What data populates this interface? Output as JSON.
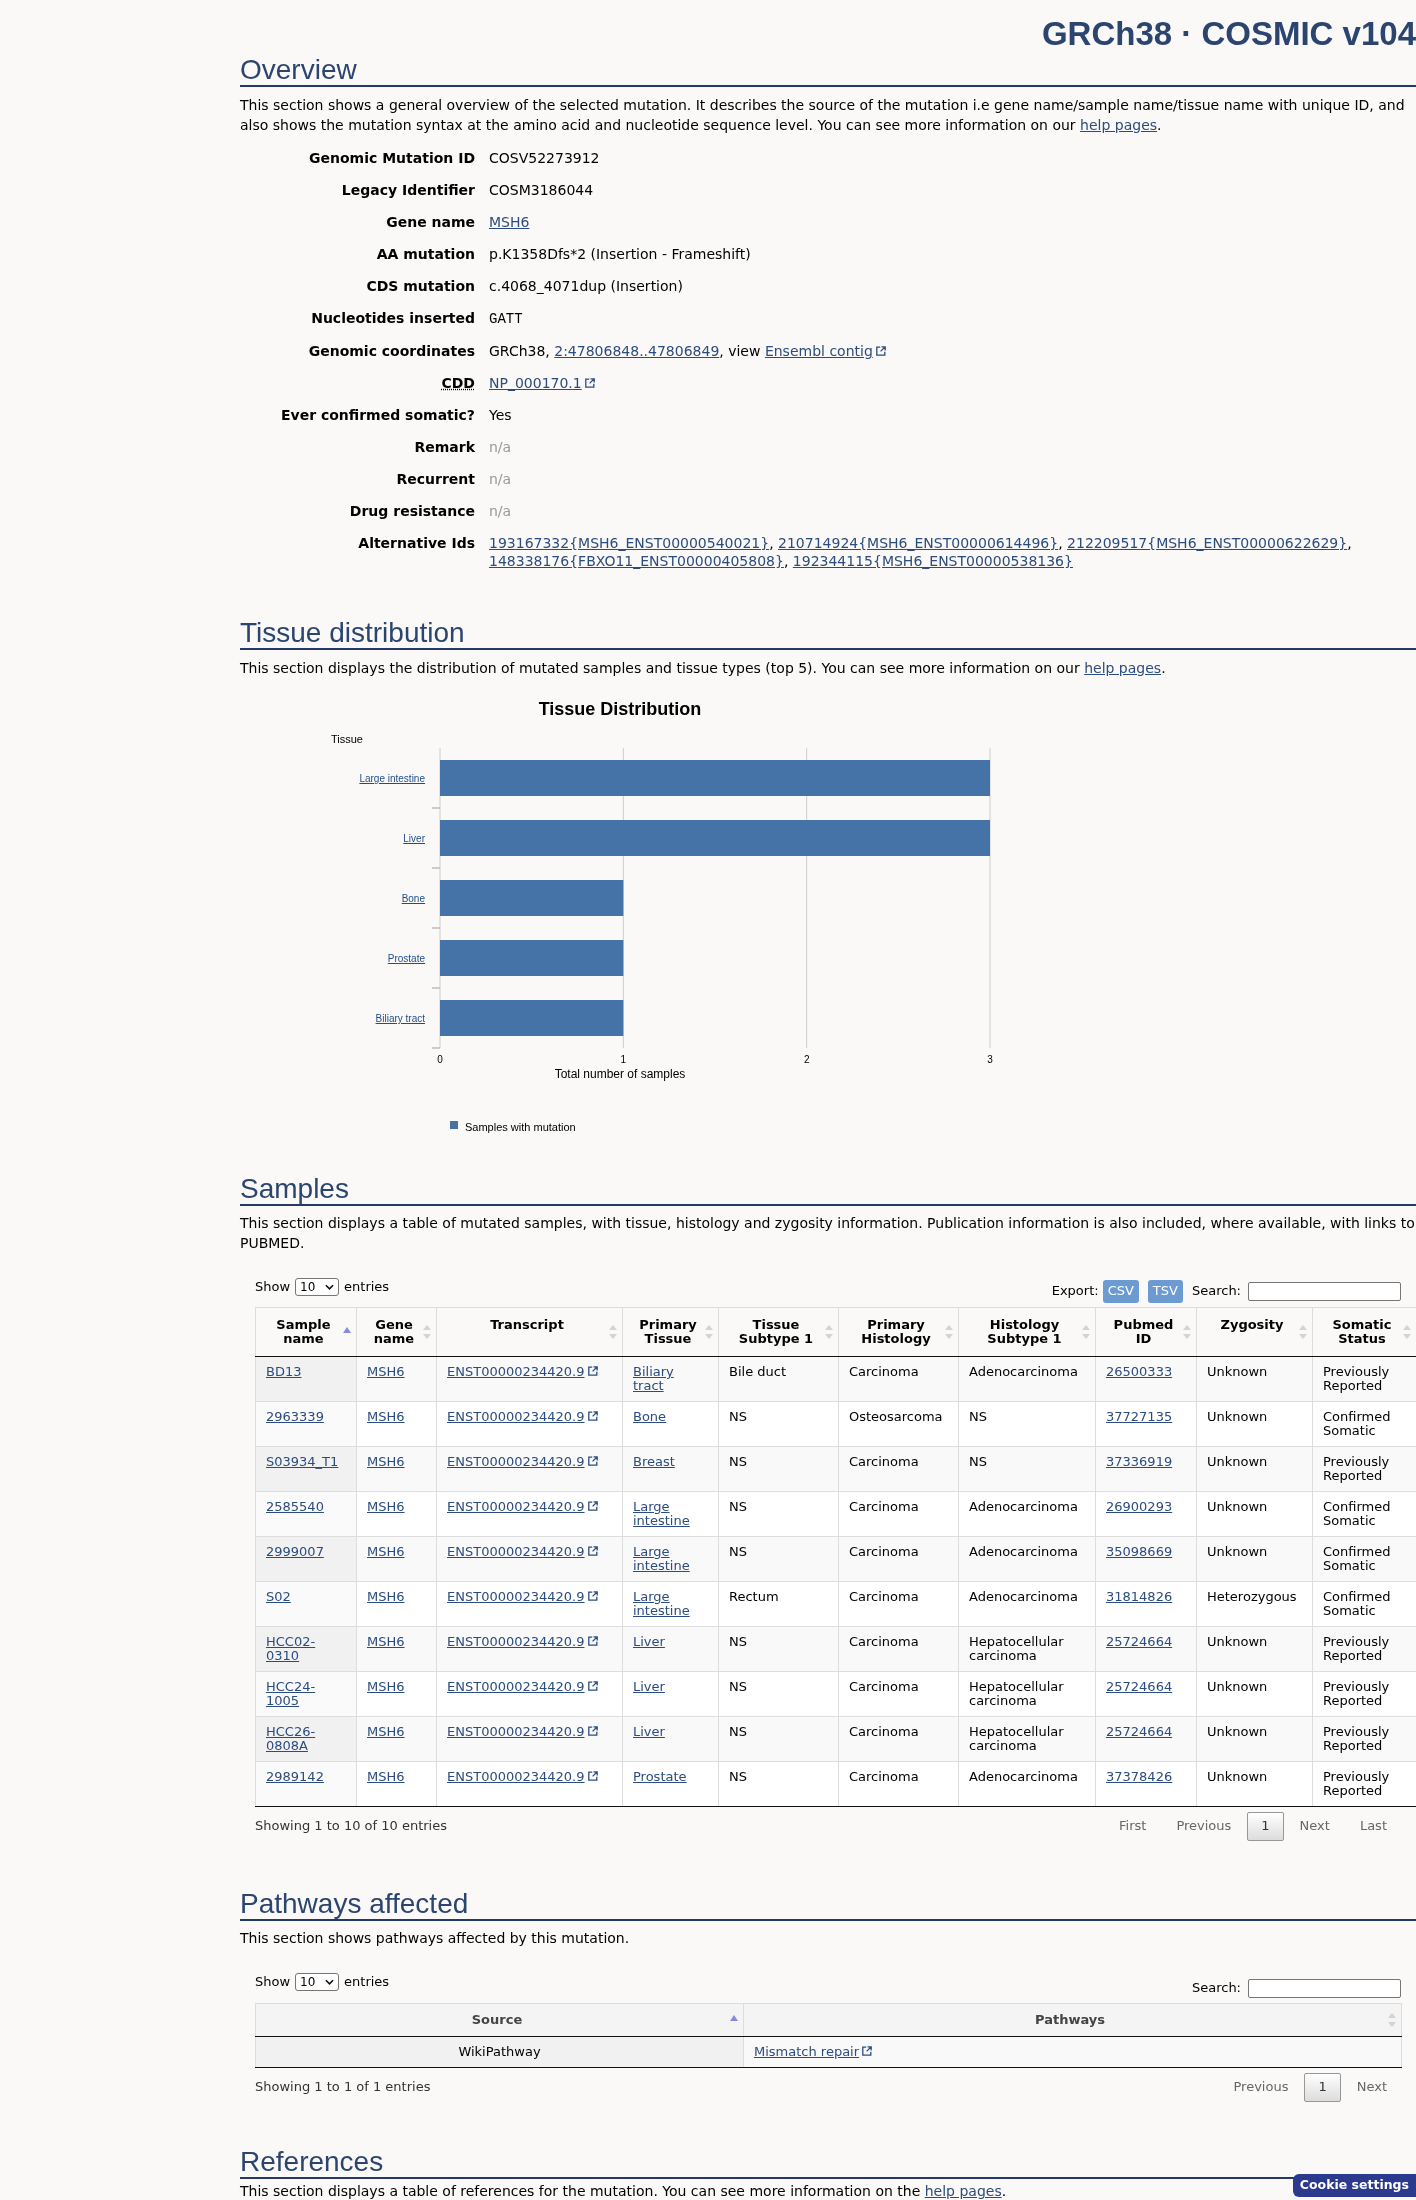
{
  "header": {
    "title": "GRCh38 · COSMIC v104"
  },
  "overview": {
    "heading": "Overview",
    "description": [
      {
        "kind": "text",
        "text": "This section shows a general overview of the selected mutation. It describes the source of the mutation i.e gene name/sample name/tissue name with unique ID, and also shows the mutation syntax at the amino acid and nucleotide sequence level. You can see more information on our "
      },
      {
        "kind": "link",
        "text": "help pages"
      },
      {
        "kind": "text",
        "text": "."
      }
    ],
    "rows": [
      {
        "label": "Genomic Mutation ID",
        "abbr": false,
        "value": [
          {
            "kind": "text",
            "text": "COSV52273912"
          }
        ]
      },
      {
        "label": "Legacy Identifier",
        "abbr": false,
        "value": [
          {
            "kind": "text",
            "text": "COSM3186044"
          }
        ]
      },
      {
        "label": "Gene name",
        "abbr": false,
        "value": [
          {
            "kind": "link",
            "text": "MSH6"
          }
        ]
      },
      {
        "label": "AA mutation",
        "abbr": false,
        "value": [
          {
            "kind": "text",
            "text": "p.K1358Dfs*2 (Insertion - Frameshift)"
          }
        ]
      },
      {
        "label": "CDS mutation",
        "abbr": false,
        "value": [
          {
            "kind": "text",
            "text": "c.4068_4071dup (Insertion)"
          }
        ]
      },
      {
        "label": "Nucleotides inserted",
        "abbr": false,
        "value": [
          {
            "kind": "code",
            "text": "GATT"
          }
        ]
      },
      {
        "label": "Genomic coordinates",
        "abbr": false,
        "value": [
          {
            "kind": "text",
            "text": "GRCh38, "
          },
          {
            "kind": "link",
            "text": "2:47806848..47806849"
          },
          {
            "kind": "text",
            "text": ", view "
          },
          {
            "kind": "external_link",
            "text": "Ensembl contig"
          }
        ]
      },
      {
        "label": "CDD",
        "abbr": true,
        "value": [
          {
            "kind": "external_link",
            "text": "NP_000170.1"
          }
        ]
      },
      {
        "label": "Ever confirmed somatic?",
        "abbr": false,
        "value": [
          {
            "kind": "text",
            "text": "Yes"
          }
        ]
      },
      {
        "label": "Remark",
        "abbr": false,
        "value": [
          {
            "kind": "muted",
            "text": "n/a"
          }
        ]
      },
      {
        "label": "Recurrent",
        "abbr": false,
        "value": [
          {
            "kind": "muted",
            "text": "n/a"
          }
        ]
      },
      {
        "label": "Drug resistance",
        "abbr": false,
        "value": [
          {
            "kind": "muted",
            "text": "n/a"
          }
        ]
      },
      {
        "label": "Alternative Ids",
        "abbr": false,
        "value": [
          {
            "kind": "link",
            "text": "193167332{MSH6_ENST00000540021}"
          },
          {
            "kind": "text",
            "text": ", "
          },
          {
            "kind": "link",
            "text": "210714924{MSH6_ENST00000614496}"
          },
          {
            "kind": "text",
            "text": ", "
          },
          {
            "kind": "link",
            "text": "212209517{MSH6_ENST00000622629}"
          },
          {
            "kind": "text",
            "text": ", "
          },
          {
            "kind": "link",
            "text": "148338176{FBXO11_ENST00000405808}"
          },
          {
            "kind": "text",
            "text": ", "
          },
          {
            "kind": "link",
            "text": "192344115{MSH6_ENST00000538136}"
          }
        ]
      }
    ]
  },
  "tissue_distribution": {
    "heading": "Tissue distribution",
    "description": [
      {
        "kind": "text",
        "text": "This section displays the distribution of mutated samples and tissue types (top 5). You can see more information on our "
      },
      {
        "kind": "link",
        "text": "help pages"
      },
      {
        "kind": "text",
        "text": "."
      }
    ],
    "chart_data": {
      "type": "bar",
      "orientation": "horizontal",
      "title": "Tissue Distribution",
      "xlabel": "Total number of samples",
      "ylabel": "Tissue",
      "categories": [
        "Large intestine",
        "Liver",
        "Bone",
        "Prostate",
        "Biliary tract"
      ],
      "series": [
        {
          "name": "Samples with mutation",
          "color": "#4573a7",
          "values": [
            3,
            3,
            1,
            1,
            1
          ]
        }
      ],
      "xlim": [
        0,
        3
      ],
      "xticks": [
        0,
        1,
        2,
        3
      ]
    }
  },
  "samples": {
    "heading": "Samples",
    "description": [
      {
        "kind": "text",
        "text": "This section displays a table of mutated samples, with tissue, histology and zygosity information. Publication information is also included, where available, with links to PUBMED."
      }
    ],
    "length_menu": {
      "label_before": "Show",
      "value": "10",
      "label_after": "entries"
    },
    "export": {
      "label": "Export:",
      "buttons": [
        "CSV",
        "TSV"
      ]
    },
    "search": {
      "label": "Search:"
    },
    "table": {
      "columns": [
        {
          "label": "Sample name",
          "sorted": true
        },
        {
          "label": "Gene name",
          "sorted": false
        },
        {
          "label": "Transcript",
          "sorted": false
        },
        {
          "label": "Primary Tissue",
          "sorted": false
        },
        {
          "label": "Tissue Subtype 1",
          "sorted": false
        },
        {
          "label": "Primary Histology",
          "sorted": false
        },
        {
          "label": "Histology Subtype 1",
          "sorted": false
        },
        {
          "label": "Pubmed ID",
          "sorted": false
        },
        {
          "label": "Zygosity",
          "sorted": false
        },
        {
          "label": "Somatic Status",
          "sorted": false
        }
      ],
      "rows": [
        [
          {
            "kind": "link",
            "text": "BD13"
          },
          {
            "kind": "link",
            "text": "MSH6"
          },
          {
            "kind": "external_link",
            "text": "ENST00000234420.9"
          },
          {
            "kind": "link",
            "text": "Biliary tract"
          },
          {
            "kind": "text",
            "text": "Bile duct"
          },
          {
            "kind": "text",
            "text": "Carcinoma"
          },
          {
            "kind": "text",
            "text": "Adenocarcinoma"
          },
          {
            "kind": "link",
            "text": "26500333"
          },
          {
            "kind": "text",
            "text": "Unknown"
          },
          {
            "kind": "text",
            "text": "Previously Reported"
          }
        ],
        [
          {
            "kind": "link",
            "text": "2963339"
          },
          {
            "kind": "link",
            "text": "MSH6"
          },
          {
            "kind": "external_link",
            "text": "ENST00000234420.9"
          },
          {
            "kind": "link",
            "text": "Bone"
          },
          {
            "kind": "text",
            "text": "NS"
          },
          {
            "kind": "text",
            "text": "Osteosarcoma"
          },
          {
            "kind": "text",
            "text": "NS"
          },
          {
            "kind": "link",
            "text": "37727135"
          },
          {
            "kind": "text",
            "text": "Unknown"
          },
          {
            "kind": "text",
            "text": "Confirmed Somatic"
          }
        ],
        [
          {
            "kind": "link",
            "text": "S03934_T1"
          },
          {
            "kind": "link",
            "text": "MSH6"
          },
          {
            "kind": "external_link",
            "text": "ENST00000234420.9"
          },
          {
            "kind": "link",
            "text": "Breast"
          },
          {
            "kind": "text",
            "text": "NS"
          },
          {
            "kind": "text",
            "text": "Carcinoma"
          },
          {
            "kind": "text",
            "text": "NS"
          },
          {
            "kind": "link",
            "text": "37336919"
          },
          {
            "kind": "text",
            "text": "Unknown"
          },
          {
            "kind": "text",
            "text": "Previously Reported"
          }
        ],
        [
          {
            "kind": "link",
            "text": "2585540"
          },
          {
            "kind": "link",
            "text": "MSH6"
          },
          {
            "kind": "external_link",
            "text": "ENST00000234420.9"
          },
          {
            "kind": "link",
            "text": "Large intestine"
          },
          {
            "kind": "text",
            "text": "NS"
          },
          {
            "kind": "text",
            "text": "Carcinoma"
          },
          {
            "kind": "text",
            "text": "Adenocarcinoma"
          },
          {
            "kind": "link",
            "text": "26900293"
          },
          {
            "kind": "text",
            "text": "Unknown"
          },
          {
            "kind": "text",
            "text": "Confirmed Somatic"
          }
        ],
        [
          {
            "kind": "link",
            "text": "2999007"
          },
          {
            "kind": "link",
            "text": "MSH6"
          },
          {
            "kind": "external_link",
            "text": "ENST00000234420.9"
          },
          {
            "kind": "link",
            "text": "Large intestine"
          },
          {
            "kind": "text",
            "text": "NS"
          },
          {
            "kind": "text",
            "text": "Carcinoma"
          },
          {
            "kind": "text",
            "text": "Adenocarcinoma"
          },
          {
            "kind": "link",
            "text": "35098669"
          },
          {
            "kind": "text",
            "text": "Unknown"
          },
          {
            "kind": "text",
            "text": "Confirmed Somatic"
          }
        ],
        [
          {
            "kind": "link",
            "text": "S02"
          },
          {
            "kind": "link",
            "text": "MSH6"
          },
          {
            "kind": "external_link",
            "text": "ENST00000234420.9"
          },
          {
            "kind": "link",
            "text": "Large intestine"
          },
          {
            "kind": "text",
            "text": "Rectum"
          },
          {
            "kind": "text",
            "text": "Carcinoma"
          },
          {
            "kind": "text",
            "text": "Adenocarcinoma"
          },
          {
            "kind": "link",
            "text": "31814826"
          },
          {
            "kind": "text",
            "text": "Heterozygous"
          },
          {
            "kind": "text",
            "text": "Confirmed Somatic"
          }
        ],
        [
          {
            "kind": "link",
            "text": "HCC02-0310"
          },
          {
            "kind": "link",
            "text": "MSH6"
          },
          {
            "kind": "external_link",
            "text": "ENST00000234420.9"
          },
          {
            "kind": "link",
            "text": "Liver"
          },
          {
            "kind": "text",
            "text": "NS"
          },
          {
            "kind": "text",
            "text": "Carcinoma"
          },
          {
            "kind": "text",
            "text": "Hepatocellular carcinoma"
          },
          {
            "kind": "link",
            "text": "25724664"
          },
          {
            "kind": "text",
            "text": "Unknown"
          },
          {
            "kind": "text",
            "text": "Previously Reported"
          }
        ],
        [
          {
            "kind": "link",
            "text": "HCC24-1005"
          },
          {
            "kind": "link",
            "text": "MSH6"
          },
          {
            "kind": "external_link",
            "text": "ENST00000234420.9"
          },
          {
            "kind": "link",
            "text": "Liver"
          },
          {
            "kind": "text",
            "text": "NS"
          },
          {
            "kind": "text",
            "text": "Carcinoma"
          },
          {
            "kind": "text",
            "text": "Hepatocellular carcinoma"
          },
          {
            "kind": "link",
            "text": "25724664"
          },
          {
            "kind": "text",
            "text": "Unknown"
          },
          {
            "kind": "text",
            "text": "Previously Reported"
          }
        ],
        [
          {
            "kind": "link",
            "text": "HCC26-0808A"
          },
          {
            "kind": "link",
            "text": "MSH6"
          },
          {
            "kind": "external_link",
            "text": "ENST00000234420.9"
          },
          {
            "kind": "link",
            "text": "Liver"
          },
          {
            "kind": "text",
            "text": "NS"
          },
          {
            "kind": "text",
            "text": "Carcinoma"
          },
          {
            "kind": "text",
            "text": "Hepatocellular carcinoma"
          },
          {
            "kind": "link",
            "text": "25724664"
          },
          {
            "kind": "text",
            "text": "Unknown"
          },
          {
            "kind": "text",
            "text": "Previously Reported"
          }
        ],
        [
          {
            "kind": "link",
            "text": "2989142"
          },
          {
            "kind": "link",
            "text": "MSH6"
          },
          {
            "kind": "external_link",
            "text": "ENST00000234420.9"
          },
          {
            "kind": "link",
            "text": "Prostate"
          },
          {
            "kind": "text",
            "text": "NS"
          },
          {
            "kind": "text",
            "text": "Carcinoma"
          },
          {
            "kind": "text",
            "text": "Adenocarcinoma"
          },
          {
            "kind": "link",
            "text": "37378426"
          },
          {
            "kind": "text",
            "text": "Unknown"
          },
          {
            "kind": "text",
            "text": "Previously Reported"
          }
        ]
      ]
    },
    "info": "Showing 1 to 10 of 10 entries",
    "pagination": [
      {
        "label": "First",
        "selected": false,
        "disabled": true
      },
      {
        "label": "Previous",
        "selected": false,
        "disabled": true
      },
      {
        "label": "1",
        "selected": true,
        "disabled": false
      },
      {
        "label": "Next",
        "selected": false,
        "disabled": true
      },
      {
        "label": "Last",
        "selected": false,
        "disabled": true
      }
    ]
  },
  "pathways": {
    "heading": "Pathways affected",
    "description": [
      {
        "kind": "text",
        "text": "This section shows pathways affected by this mutation."
      }
    ],
    "length_menu": {
      "label_before": "Show",
      "value": "10",
      "label_after": "entries"
    },
    "search": {
      "label": "Search:"
    },
    "table": {
      "columns": [
        {
          "label": "Source",
          "sorted": true
        },
        {
          "label": "Pathways",
          "sorted": false
        }
      ],
      "rows": [
        [
          {
            "kind": "text",
            "text": "WikiPathway"
          },
          {
            "kind": "external_link",
            "text": "Mismatch repair"
          }
        ]
      ]
    },
    "info": "Showing 1 to 1 of 1 entries",
    "pagination": [
      {
        "label": "Previous",
        "selected": false,
        "disabled": true
      },
      {
        "label": "1",
        "selected": true,
        "disabled": false
      },
      {
        "label": "Next",
        "selected": false,
        "disabled": true
      }
    ]
  },
  "references": {
    "heading": "References",
    "description": [
      {
        "kind": "text",
        "text": "This section displays a table of references for the mutation. You can see more information on the "
      },
      {
        "kind": "link",
        "text": "help pages"
      },
      {
        "kind": "text",
        "text": "."
      }
    ]
  },
  "cookie_button": {
    "label": "Cookie settings"
  }
}
